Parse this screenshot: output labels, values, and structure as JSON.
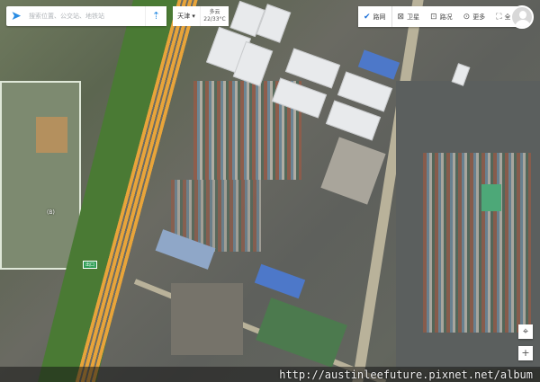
{
  "search": {
    "placeholder": "搜索位置、公交站、地铁站"
  },
  "city": {
    "label": "天津 ▾"
  },
  "weather": {
    "condition": "多云",
    "temp": "22/33°C"
  },
  "toolbar": {
    "items": [
      {
        "label": "路网",
        "icon": "check-circle-icon"
      },
      {
        "label": "卫星",
        "icon": "satellite-icon"
      },
      {
        "label": "路况",
        "icon": "traffic-icon"
      },
      {
        "label": "更多",
        "icon": "more-icon"
      },
      {
        "label": "全屏",
        "icon": "fullscreen-icon"
      }
    ]
  },
  "map_labels": {
    "building": "(B)",
    "ramp": "出口"
  },
  "watermark": "http://austinleefuture.pixnet.net/album"
}
